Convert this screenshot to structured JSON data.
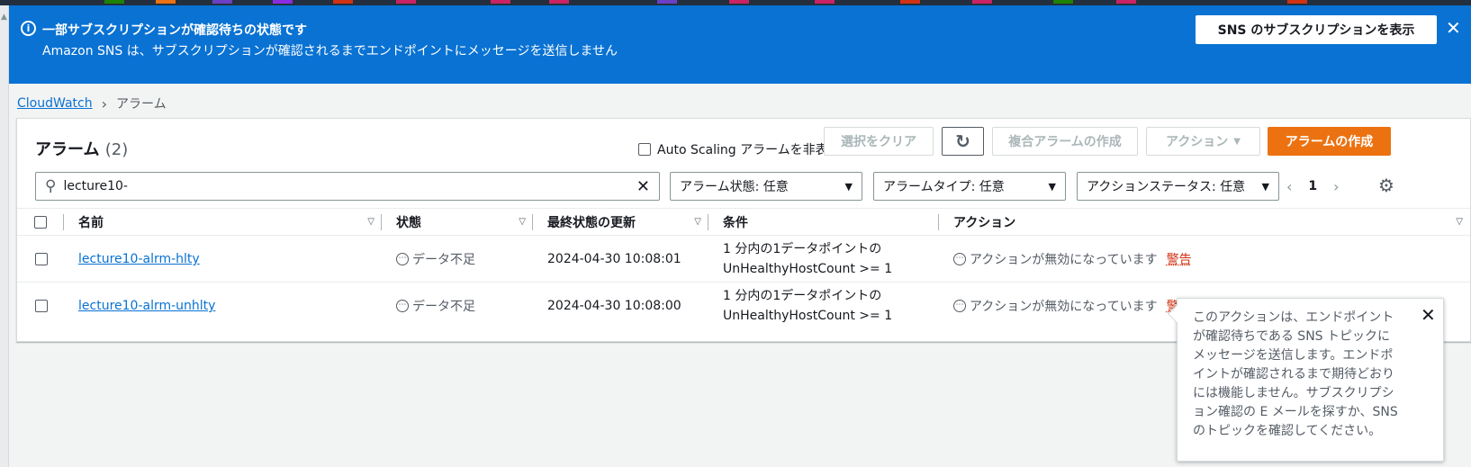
{
  "flash": {
    "title": "一部サブスクリプションが確認待ちの状態です",
    "message": "Amazon SNS は、サブスクリプションが確認されるまでエンドポイントにメッセージを送信しません",
    "view_button": "SNS のサブスクリプションを表示",
    "bg_color": "#0972d3"
  },
  "breadcrumb": {
    "root": "CloudWatch",
    "current": "アラーム"
  },
  "panel": {
    "title": "アラーム",
    "count": "(2)",
    "hide_autoscaling": "Auto Scaling アラームを非表示",
    "clear_button": "選択をクリア",
    "composite_button": "複合アラームの作成",
    "actions_button": "アクション",
    "create_button": "アラームの作成",
    "accent_color": "#ec7211"
  },
  "filters": {
    "search_value": "lecture10-",
    "alarm_state": "アラーム状態: 任意",
    "alarm_type": "アラームタイプ: 任意",
    "action_status": "アクションステータス: 任意"
  },
  "pagination": {
    "page": "1"
  },
  "table": {
    "columns": [
      "名前",
      "状態",
      "最終状態の更新",
      "条件",
      "アクション"
    ],
    "rows": [
      {
        "name": "lecture10-alrm-hlty",
        "state": "データ不足",
        "updated": "2024-04-30 10:08:01",
        "condition_line1": "1 分内の1データポイントの",
        "condition_line2": "UnHealthyHostCount >= 1",
        "action": "アクションが無効になっています",
        "warning": "警告"
      },
      {
        "name": "lecture10-alrm-unhlty",
        "state": "データ不足",
        "updated": "2024-04-30 10:08:00",
        "condition_line1": "1 分内の1データポイントの",
        "condition_line2": "UnHealthyHostCount >= 1",
        "action": "アクションが無効になっています",
        "warning": "警告"
      }
    ]
  },
  "popover": {
    "text": "このアクションは、エンドポイントが確認待ちである SNS トピックにメッセージを送信します。エンドポイントが確認されるまで期待どおりには機能しません。サブスクリプション確認の E メールを探すか、SNS のトピックを確認してください。"
  }
}
